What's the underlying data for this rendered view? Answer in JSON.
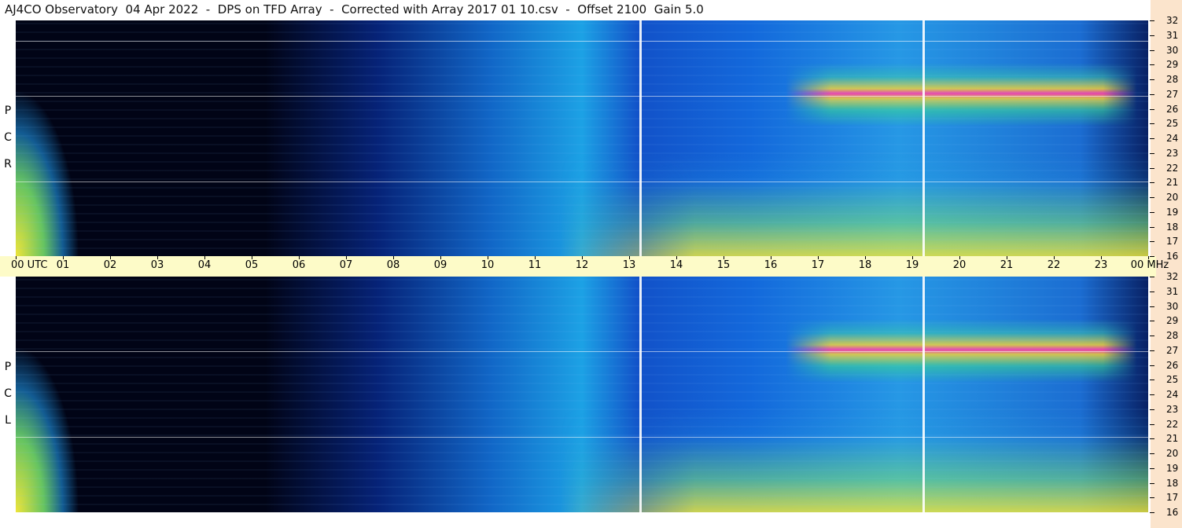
{
  "title": "AJ4CO Observatory  04 Apr 2022  -  DPS on TFD Array  -  Corrected with Array 2017 01 10.csv  -  Offset 2100  Gain 5.0",
  "panels": {
    "top": {
      "polarization_letters": [
        "P",
        "C",
        "R"
      ]
    },
    "bottom": {
      "polarization_letters": [
        "P",
        "C",
        "L"
      ]
    }
  },
  "time_axis": {
    "labels": [
      "00  UTC",
      "01",
      "02",
      "03",
      "04",
      "05",
      "06",
      "07",
      "08",
      "09",
      "10",
      "11",
      "12",
      "13",
      "14",
      "15",
      "16",
      "17",
      "18",
      "19",
      "20",
      "21",
      "22",
      "23",
      "00 MHz"
    ]
  },
  "freq_axis": {
    "labels": [
      "32",
      "31",
      "30",
      "29",
      "28",
      "27",
      "26",
      "25",
      "24",
      "23",
      "22",
      "21",
      "20",
      "19",
      "18",
      "17",
      "16"
    ]
  },
  "colors": {
    "background_dark": "#010416",
    "axis_band": "#fdfbc8",
    "right_strip": "#fbe4cc",
    "hot": "#ff3caa",
    "warm": "#f0d23c"
  }
}
